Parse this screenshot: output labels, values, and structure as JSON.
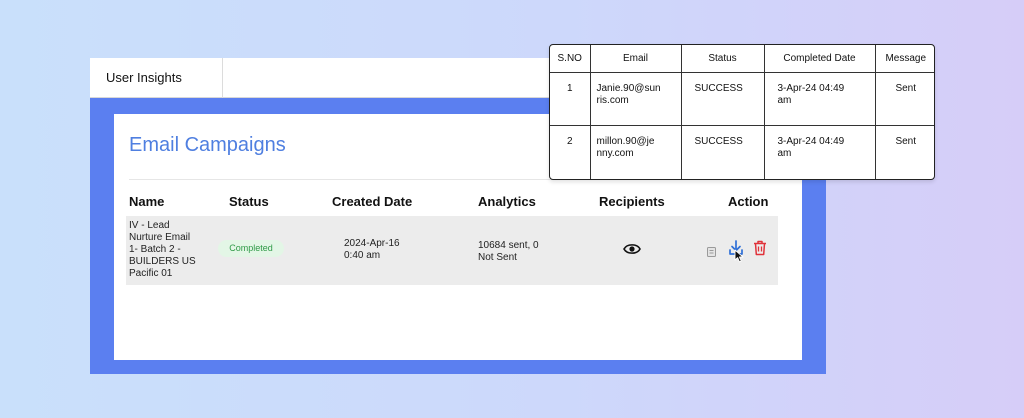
{
  "tab": {
    "label": "User Insights"
  },
  "card": {
    "title": "Email Campaigns"
  },
  "columns": {
    "name": "Name",
    "status": "Status",
    "created": "Created Date",
    "analytics": "Analytics",
    "recipients": "Recipients",
    "action": "Action"
  },
  "row": {
    "name_lines": [
      "IV - Lead",
      "Nurture Email",
      "1- Batch 2 -",
      "BUILDERS US",
      "Pacific 01"
    ],
    "status": "Completed",
    "created_lines": [
      "2024-Apr-16",
      "0:40 am"
    ],
    "analytics_lines": [
      "10684 sent, 0",
      "Not Sent"
    ],
    "recipients_icon": "eye-icon",
    "actions": [
      "copy-icon",
      "download-icon",
      "trash-icon"
    ]
  },
  "popup": {
    "headers": [
      "S.NO",
      "Email",
      "Status",
      "Completed Date",
      "Message"
    ],
    "rows": [
      {
        "sno": "1",
        "email_lines": [
          "Janie.90@sun",
          "ris.com"
        ],
        "status": "SUCCESS",
        "date_lines": [
          "3-Apr-24 04:49",
          "am"
        ],
        "message": "Sent"
      },
      {
        "sno": "2",
        "email_lines": [
          "millon.90@je",
          "nny.com"
        ],
        "status": "SUCCESS",
        "date_lines": [
          "3-Apr-24 04:49",
          "am"
        ],
        "message": "Sent"
      }
    ]
  },
  "colors": {
    "accent": "#4f7fe0",
    "frame": "#5b7ff0",
    "badge_bg": "#e3f6e6",
    "badge_text": "#2f9a47",
    "download": "#2f6fd6",
    "delete": "#e0323a"
  }
}
